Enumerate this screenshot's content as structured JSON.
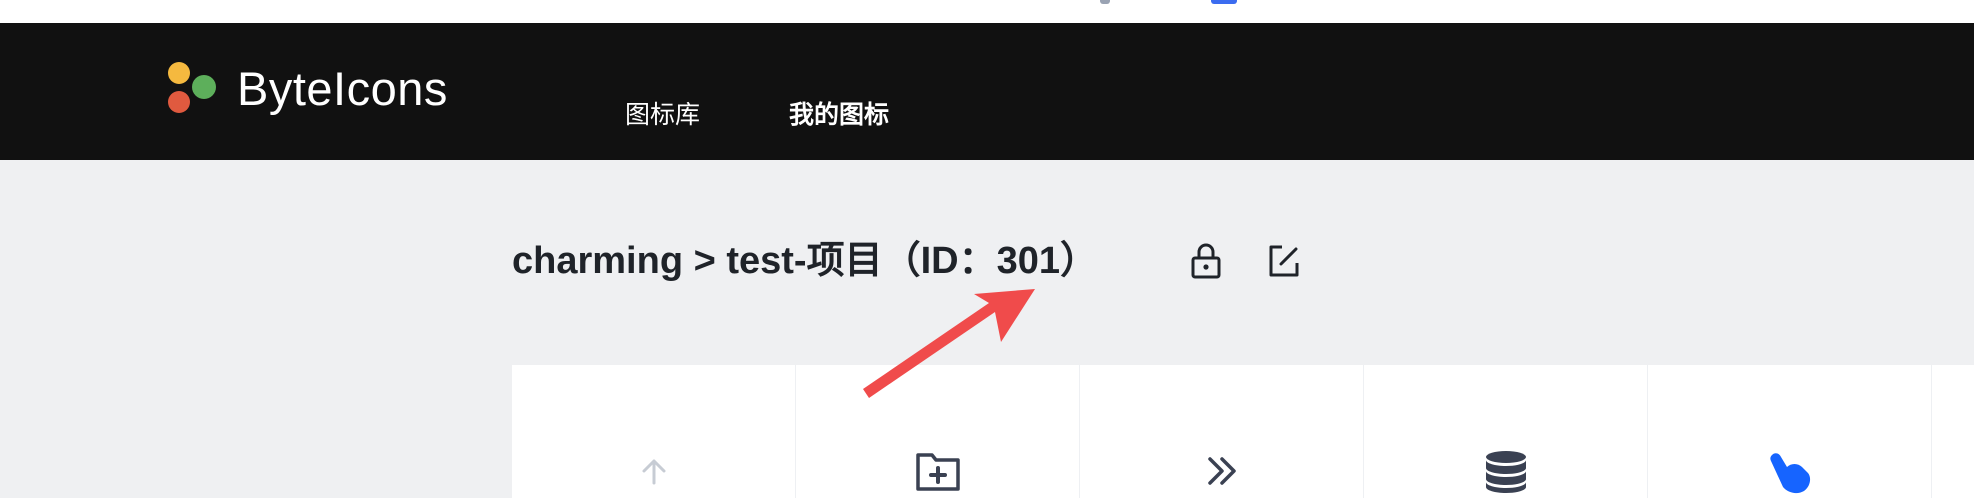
{
  "brand": {
    "name": "ByteIcons"
  },
  "nav": {
    "library": "图标库",
    "my_icons": "我的图标"
  },
  "project": {
    "title": "charming > test-项目（ID：301）"
  },
  "icons": {
    "lock": "lock-icon",
    "edit": "edit-icon",
    "upload": "upload-icon",
    "add_folder": "folder-add-icon",
    "double_right": "double-right-icon",
    "database": "database-icon",
    "pointer": "hand-pointer-icon"
  },
  "colors": {
    "navbar": "#111111",
    "background": "#eff0f2",
    "accent_blue": "#1664ff",
    "annotation_red": "#f04b4b"
  }
}
